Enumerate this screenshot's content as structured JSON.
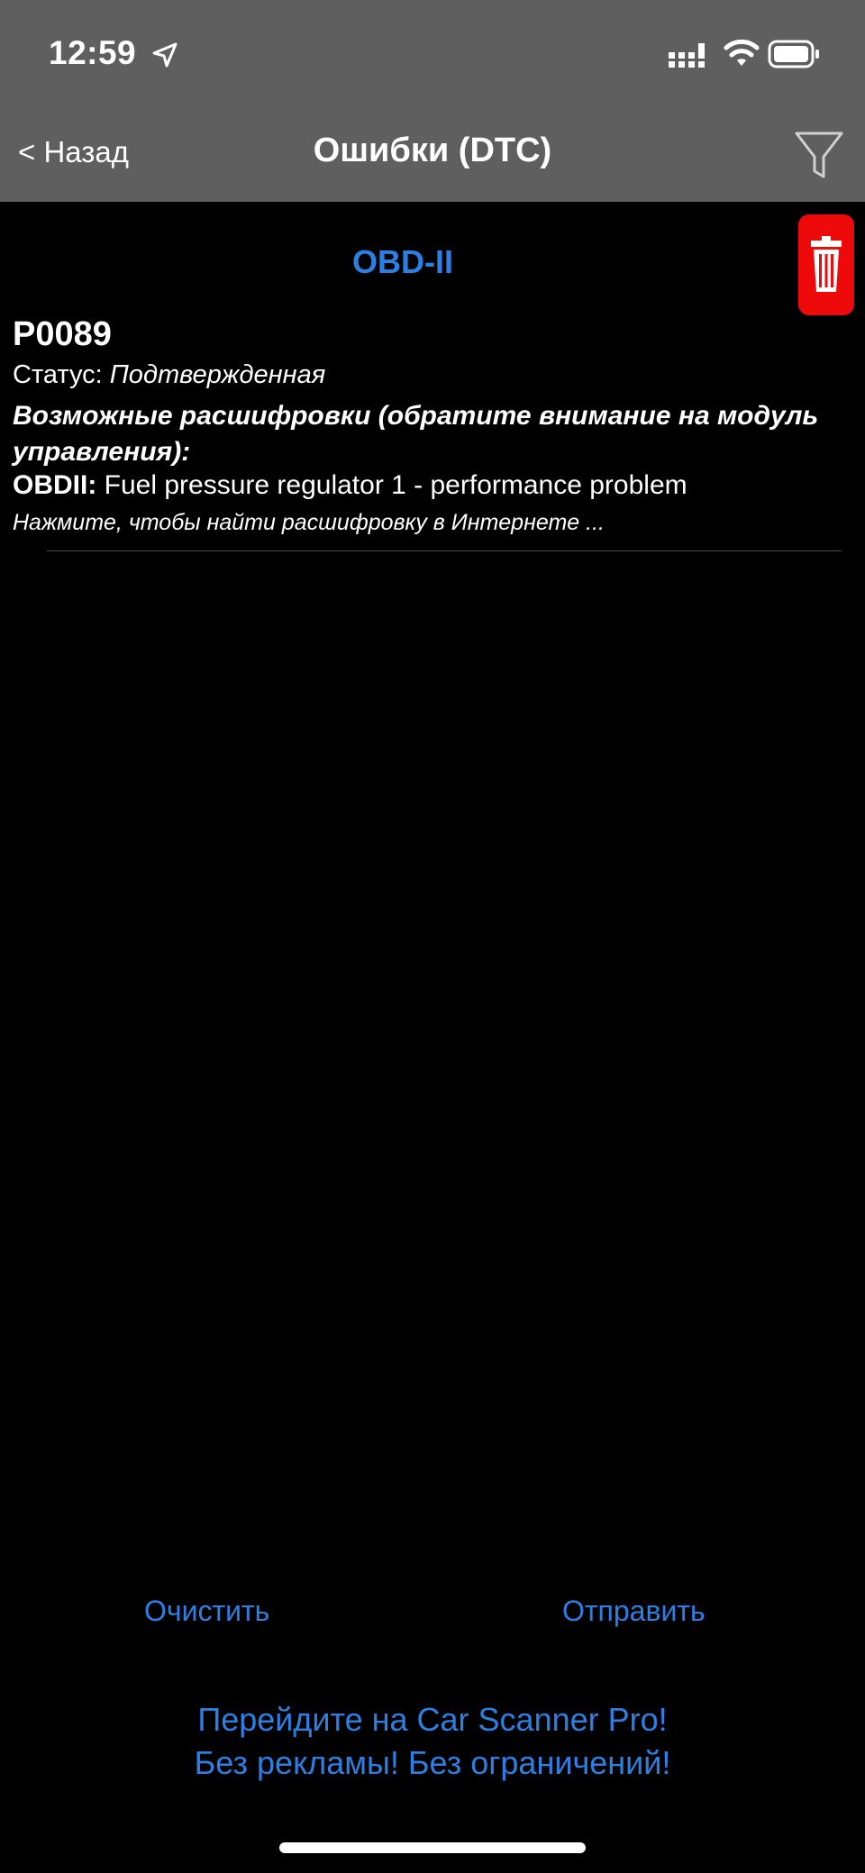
{
  "status_bar": {
    "time": "12:59"
  },
  "nav": {
    "back_label": "< Назад",
    "title": "Ошибки (DTC)"
  },
  "section": {
    "title": "OBD-II"
  },
  "dtc": {
    "code": "P0089",
    "status_label": "Статус: ",
    "status_value": "Подтвержденная",
    "decode_heading": "Возможные расшифровки (обратите внимание на модуль управления):",
    "obd_prefix": "OBDII:",
    "obd_description": " Fuel pressure regulator 1 - performance problem",
    "search_hint": "Нажмите, чтобы найти расшифровку в Интернете ..."
  },
  "actions": {
    "clear_label": "Очистить",
    "send_label": "Отправить"
  },
  "promo": {
    "line1": "Перейдите на Car Scanner Pro!",
    "line2": "Без рекламы! Без ограничений!"
  },
  "colors": {
    "accent": "#2c7fe3",
    "nav_background": "#5f5f5f",
    "delete_red": "#ee0a0a",
    "background": "#000000"
  },
  "icons": [
    "location-arrow-icon",
    "cellular-signal-icon",
    "wifi-icon",
    "battery-icon",
    "filter-icon",
    "trash-icon"
  ]
}
